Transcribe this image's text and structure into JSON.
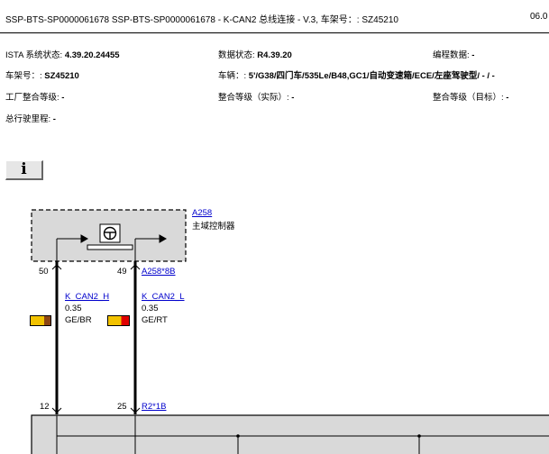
{
  "header": {
    "title": "SSP-BTS-SP0000061678 SSP-BTS-SP0000061678 - K-CAN2 总线连接 - V.3, 车架号：: SZ45210",
    "page_right": "06.0"
  },
  "info": {
    "ista_label": "ISTA 系统状态: ",
    "ista_value": "4.39.20.24455",
    "data_label": "数据状态: ",
    "data_value": "R4.39.20",
    "prog_label": "编程数据: ",
    "prog_value": "-",
    "vin_label": "车架号：: ",
    "vin_value": "SZ45210",
    "vehicle_label": "车辆：: ",
    "vehicle_value": "5'/G38/四门车/535Le/B48,GC1/自动变速箱/ECE/左座驾驶型/ - / -",
    "factory_label": "工厂整合等级: ",
    "factory_value": "-",
    "actual_label": "整合等级（实际）: ",
    "actual_value": "-",
    "target_label": "整合等级（目标）: ",
    "target_value": "-",
    "mileage_label": "总行驶里程: ",
    "mileage_value": "-"
  },
  "info_icon": "i",
  "diagram": {
    "component_id": "A258",
    "component_name": "主域控制器",
    "connector_top": "A258*8B",
    "connector_bottom": "R2*1B",
    "pin_top_left": "50",
    "pin_top_right": "49",
    "pin_bottom_left": "12",
    "pin_bottom_right": "25",
    "wire_left": {
      "signal": "K_CAN2_H",
      "size": "0.35",
      "color": "GE/BR"
    },
    "wire_right": {
      "signal": "K_CAN2_L",
      "size": "0.35",
      "color": "GE/RT"
    }
  },
  "colors": {
    "yellow": "#f2c200",
    "brown": "#8b4513",
    "red": "#e00000",
    "box_fill": "#d9d9d9",
    "link": "#0000cc"
  }
}
